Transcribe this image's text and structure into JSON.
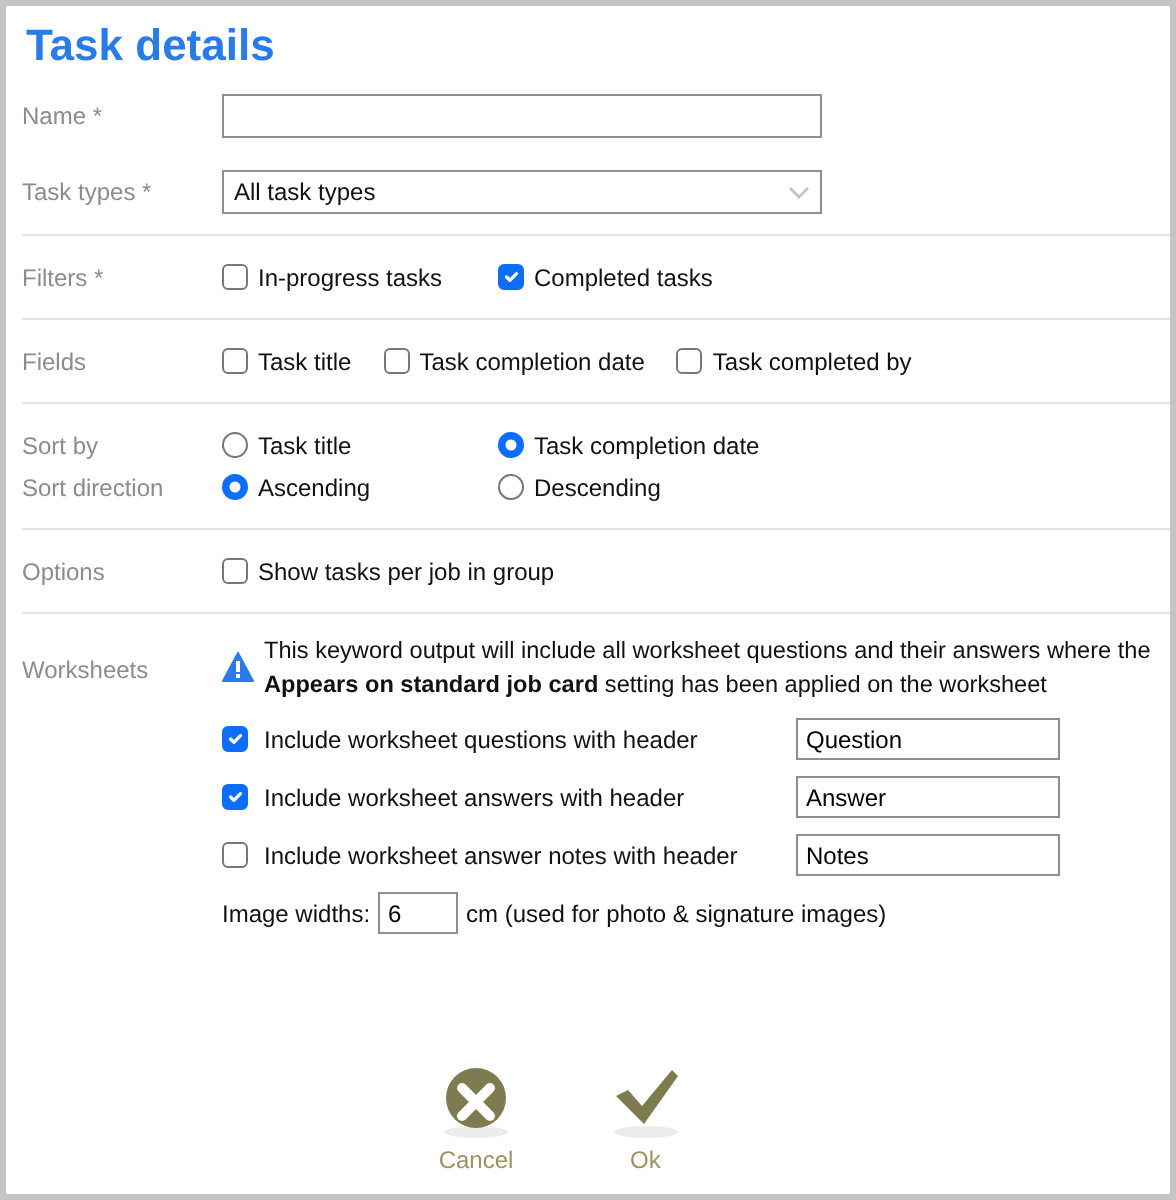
{
  "title": "Task details",
  "name_field": {
    "label": "Name *"
  },
  "task_types": {
    "label": "Task types *",
    "value": "All task types"
  },
  "filters": {
    "label": "Filters *",
    "options": [
      {
        "label": "In-progress tasks",
        "checked": false
      },
      {
        "label": "Completed tasks",
        "checked": true
      }
    ]
  },
  "fields": {
    "label": "Fields",
    "options": [
      {
        "label": "Task title",
        "checked": false
      },
      {
        "label": "Task completion date",
        "checked": false
      },
      {
        "label": "Task completed by",
        "checked": false
      }
    ]
  },
  "sort_by": {
    "label": "Sort by",
    "options": [
      {
        "label": "Task title",
        "selected": false
      },
      {
        "label": "Task completion date",
        "selected": true
      }
    ]
  },
  "sort_direction": {
    "label": "Sort direction",
    "options": [
      {
        "label": "Ascending",
        "selected": true
      },
      {
        "label": "Descending",
        "selected": false
      }
    ]
  },
  "options": {
    "label": "Options",
    "options": [
      {
        "label": "Show tasks per job in group",
        "checked": false
      }
    ]
  },
  "worksheets": {
    "label": "Worksheets",
    "notice": "This keyword output will include all worksheet questions and their answers where the **Appears on standard job card** setting has been applied on the worksheet",
    "items": [
      {
        "label": "Include worksheet questions with header",
        "checked": true,
        "header": "Question"
      },
      {
        "label": "Include worksheet answers with header",
        "checked": true,
        "header": "Answer"
      },
      {
        "label": "Include worksheet answer notes with header",
        "checked": false,
        "header": "Notes"
      }
    ],
    "image_width": {
      "label": "Image widths:",
      "value": "6",
      "unit": "cm (used for photo & signature images)"
    }
  },
  "buttons": [
    {
      "label": "Cancel",
      "kind": "cancel"
    },
    {
      "label": "Ok",
      "kind": "ok"
    }
  ]
}
